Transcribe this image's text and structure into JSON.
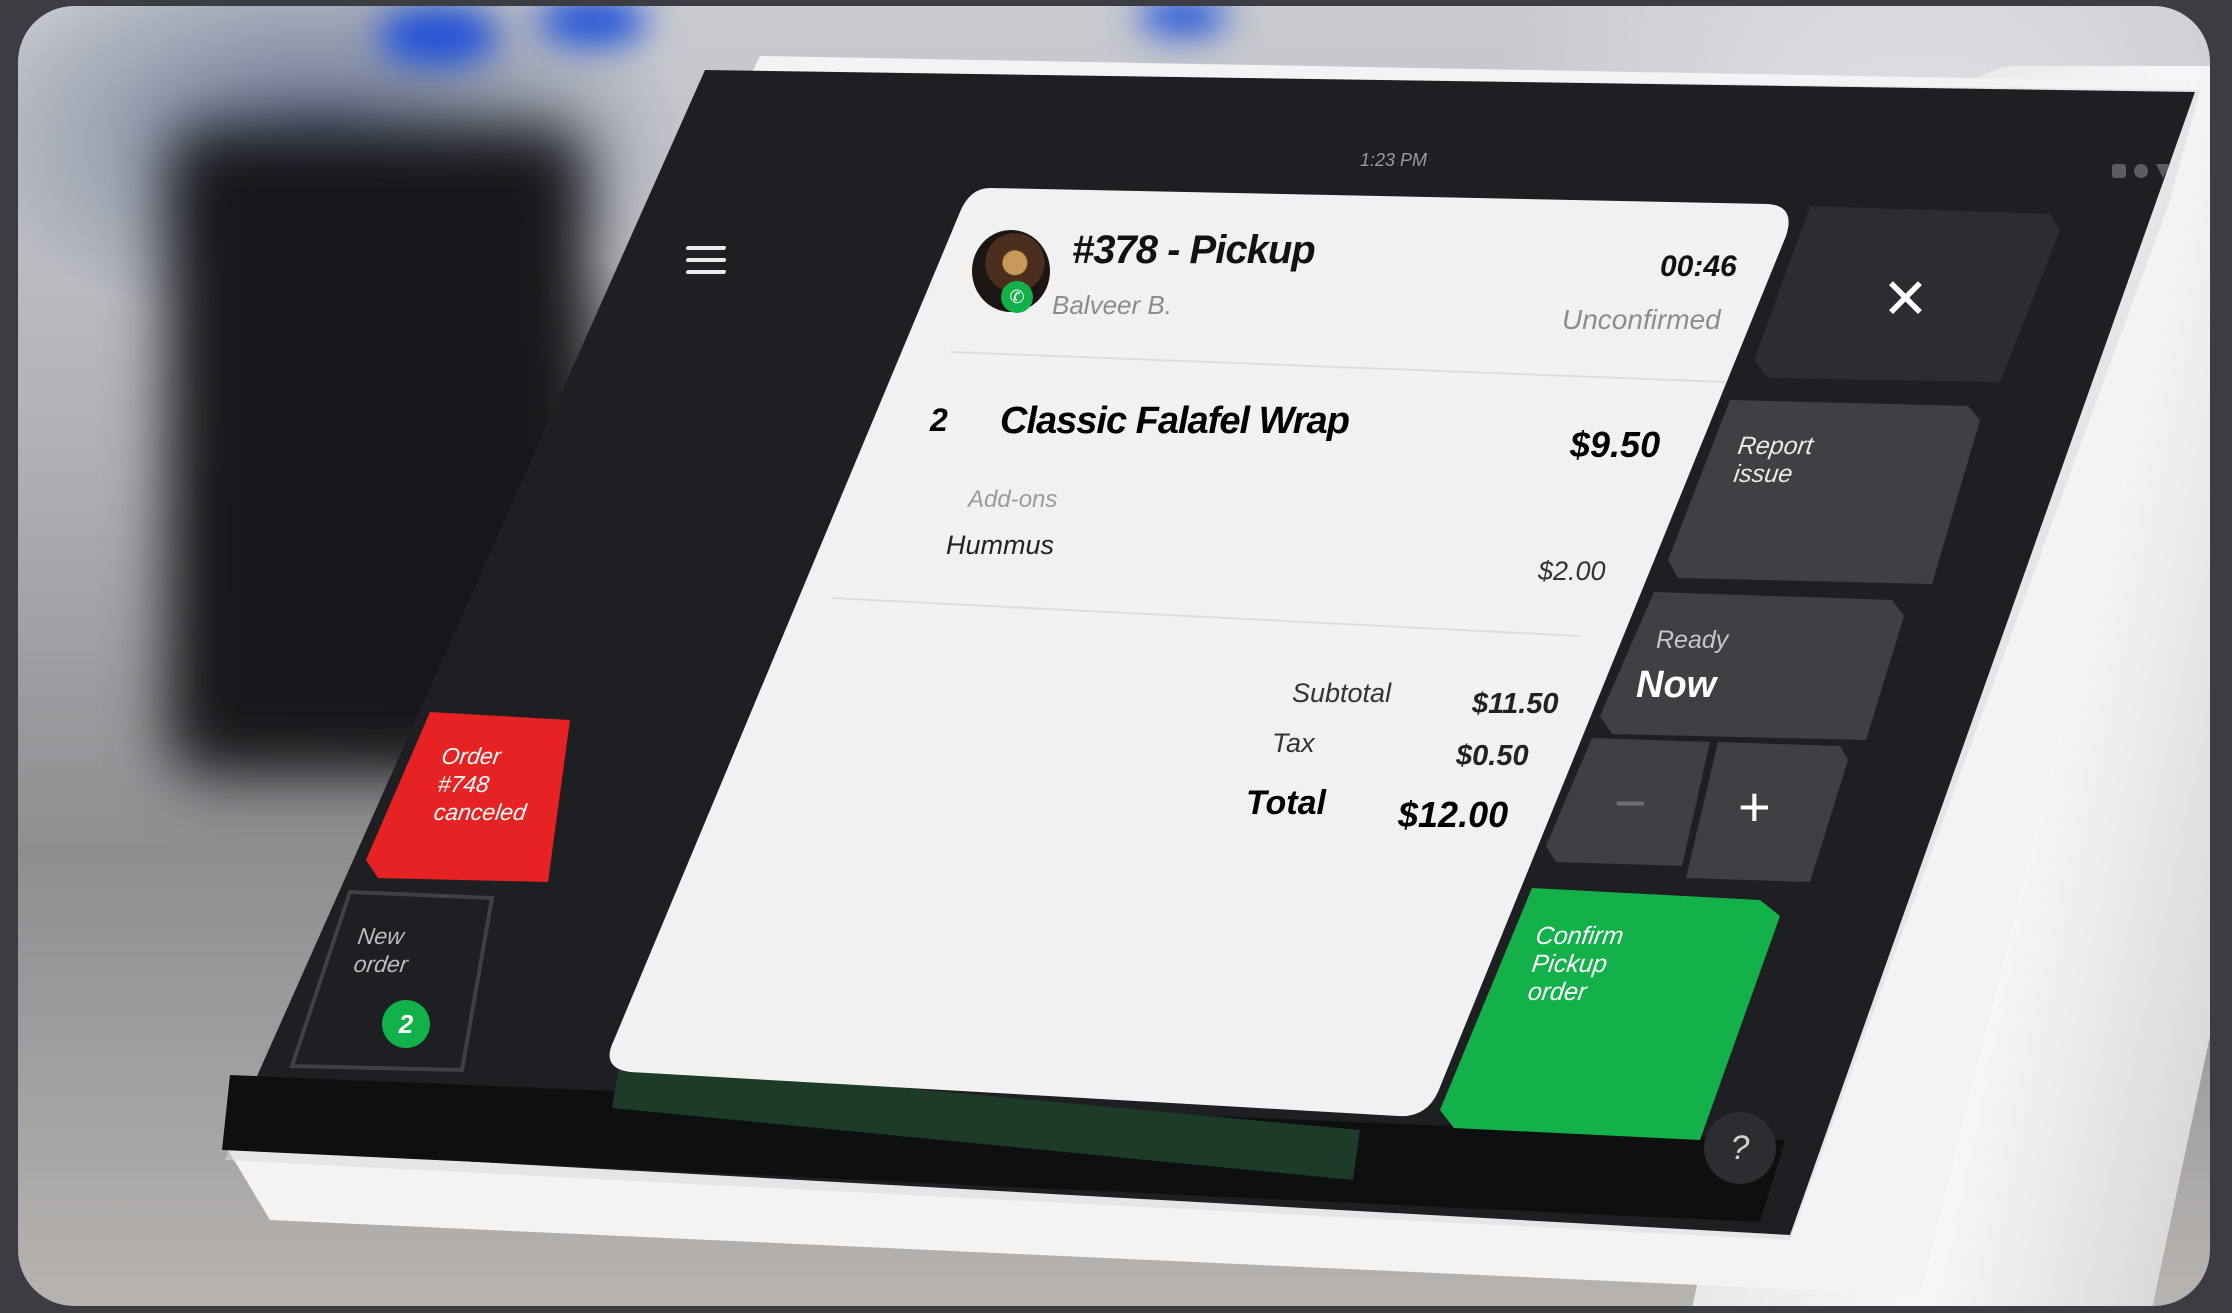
{
  "status_bar": {
    "time": "1:23 PM"
  },
  "order": {
    "title": "#378 - Pickup",
    "customer": "Balveer B.",
    "timer": "00:46",
    "status": "Unconfirmed"
  },
  "items": [
    {
      "qty": "2",
      "name": "Classic Falafel Wrap",
      "price": "$9.50",
      "addons_label": "Add-ons",
      "addon": "Hummus",
      "addon_price": "$2.00"
    }
  ],
  "totals": {
    "subtotal_label": "Subtotal",
    "subtotal": "$11.50",
    "tax_label": "Tax",
    "tax": "$0.50",
    "total_label": "Total",
    "total": "$12.00"
  },
  "actions": {
    "close_icon": "close-icon",
    "report_issue": "Report\nissue",
    "ready_label": "Ready",
    "ready_value": "Now",
    "minus": "−",
    "plus": "+",
    "confirm": "Confirm\nPickup\norder",
    "help": "?"
  },
  "sidebar": {
    "canceled_tile": "Order\n#748\ncanceled",
    "new_order_tile": "New\norder",
    "new_order_count": "2"
  },
  "colors": {
    "screen_bg": "#1e1f22",
    "card_bg": "#f1f1f1",
    "tile_bg": "#3f4044",
    "alert_red": "#e62222",
    "confirm_green": "#14b14b"
  }
}
